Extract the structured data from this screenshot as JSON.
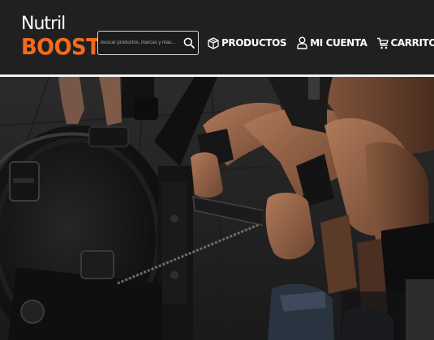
{
  "brand": {
    "line1": "Nutril",
    "line2": "BOOST",
    "accent_color": "#f26b1d"
  },
  "search": {
    "placeholder": "Buscar productos, marcas y más...",
    "icon": "search-icon"
  },
  "nav": {
    "items": [
      {
        "label": "PRODUCTOS",
        "icon": "box-icon"
      },
      {
        "label": "MI CUENTA",
        "icon": "user-icon"
      },
      {
        "label": "CARRITO",
        "icon": "cart-icon"
      }
    ]
  },
  "hero": {
    "image": "rowing-machine-athlete-photo"
  }
}
